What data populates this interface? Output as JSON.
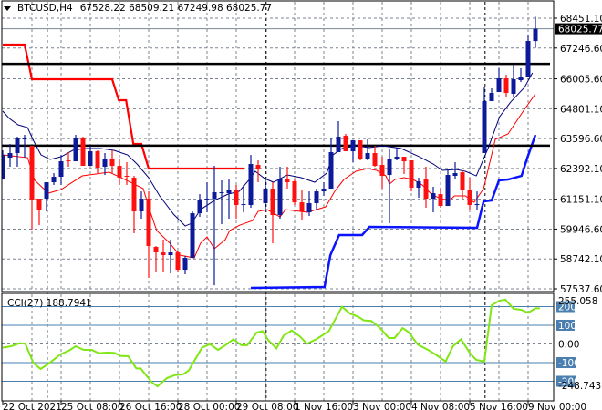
{
  "header": {
    "symbol": "BTCUSD,H4",
    "ohlc": "67528.22 68509.21 67249.98 68025.77"
  },
  "chart_data": {
    "type": "candlestick",
    "title": "BTCUSD,H4",
    "colors": {
      "bull": "#0c1a9a",
      "bear": "#ff1010",
      "ma_upper": "#00007a",
      "ma_lower": "#ff0000",
      "step_red": "#ff0000",
      "step_blue": "#0a14ff",
      "cci": "#80e614",
      "cci_level": "#4a7fb0",
      "grid": "#7a8490"
    },
    "price_axis_labels": [
      "68451.10",
      "67246.60",
      "66005.60",
      "64801.10",
      "63596.60",
      "62392.10",
      "61151.10",
      "59946.60",
      "58742.10",
      "57537.60"
    ],
    "price_range": [
      57537.6,
      68451.1
    ],
    "current_price": "68025.77",
    "x_axis_labels": [
      {
        "label": "22 Oct 2021",
        "bar": 0
      },
      {
        "label": "25 Oct 08:00",
        "bar": 8
      },
      {
        "label": "26 Oct 16:00",
        "bar": 16
      },
      {
        "label": "28 Oct 00:00",
        "bar": 24
      },
      {
        "label": "29 Oct 08:00",
        "bar": 32
      },
      {
        "label": "1 Nov 16:00",
        "bar": 40
      },
      {
        "label": "3 Nov 00:00",
        "bar": 48
      },
      {
        "label": "4 Nov 08:00",
        "bar": 56
      },
      {
        "label": "5 Nov 16:00",
        "bar": 64
      },
      {
        "label": "9 Nov 00:00",
        "bar": 72
      }
    ],
    "period_separators_bar": [
      6.1,
      36.1,
      66.1
    ],
    "candles_ohlc": [
      [
        61946,
        63122,
        61946,
        62938
      ],
      [
        62828,
        63379,
        62461,
        63012
      ],
      [
        63012,
        63673,
        62461,
        63600
      ],
      [
        63563,
        63747,
        62828,
        63637
      ],
      [
        63306,
        63306,
        59925,
        61101
      ],
      [
        61174,
        61174,
        60109,
        60733
      ],
      [
        61174,
        61836,
        60660,
        61836
      ],
      [
        61836,
        62203,
        61726,
        62056
      ],
      [
        62056,
        62938,
        61726,
        62681
      ],
      [
        62718,
        63049,
        62461,
        62681
      ],
      [
        62681,
        63747,
        62681,
        63600
      ],
      [
        63600,
        63673,
        62497,
        62497
      ],
      [
        62497,
        63306,
        62497,
        63085
      ],
      [
        63085,
        63122,
        62203,
        62424
      ],
      [
        62461,
        63012,
        62130,
        62791
      ],
      [
        62791,
        63122,
        62203,
        62497
      ],
      [
        62497,
        62755,
        61726,
        62020
      ],
      [
        62093,
        62644,
        61726,
        62056
      ],
      [
        62020,
        62093,
        59778,
        60660
      ],
      [
        60660,
        61468,
        60366,
        61174
      ],
      [
        61174,
        61468,
        57977,
        59263
      ],
      [
        59227,
        59263,
        58234,
        59006
      ],
      [
        59006,
        59521,
        58234,
        58896
      ],
      [
        58896,
        59521,
        58161,
        59006
      ],
      [
        59006,
        59080,
        58234,
        58308
      ],
      [
        58308,
        58859,
        58124,
        58786
      ],
      [
        58786,
        60660,
        58786,
        60586
      ],
      [
        60586,
        61358,
        60439,
        61138
      ],
      [
        61138,
        61836,
        60623,
        61174
      ],
      [
        61174,
        62497,
        57682,
        61432
      ],
      [
        61395,
        61909,
        60145,
        61432
      ],
      [
        61395,
        61946,
        60366,
        61542
      ],
      [
        61542,
        61726,
        60366,
        60917
      ],
      [
        60917,
        61726,
        60623,
        60954
      ],
      [
        60917,
        62938,
        60807,
        62571
      ],
      [
        62534,
        62718,
        61836,
        62350
      ],
      [
        60991,
        61946,
        60733,
        61579
      ],
      [
        61579,
        61836,
        59374,
        60513
      ],
      [
        60513,
        62461,
        60366,
        61946
      ],
      [
        61946,
        62461,
        61579,
        61836
      ],
      [
        61873,
        61946,
        60917,
        61027
      ],
      [
        61027,
        61505,
        60292,
        60660
      ],
      [
        60623,
        61468,
        60476,
        60991
      ],
      [
        60991,
        61579,
        60733,
        61468
      ],
      [
        61468,
        61836,
        61285,
        61579
      ],
      [
        61579,
        63600,
        61579,
        63049
      ],
      [
        63049,
        64298,
        63049,
        63673
      ],
      [
        63710,
        63784,
        63085,
        63085
      ],
      [
        63085,
        63526,
        62644,
        63526
      ],
      [
        63526,
        63526,
        62718,
        62755
      ],
      [
        62755,
        63563,
        62718,
        63012
      ],
      [
        63012,
        63306,
        62461,
        62497
      ],
      [
        62534,
        62865,
        61579,
        62093
      ],
      [
        62130,
        63196,
        60182,
        62791
      ],
      [
        62755,
        63232,
        62718,
        62865
      ],
      [
        62865,
        62865,
        62167,
        62681
      ],
      [
        62718,
        62718,
        61468,
        61615
      ],
      [
        61615,
        62020,
        61211,
        61873
      ],
      [
        61946,
        62461,
        60807,
        61174
      ],
      [
        61174,
        61652,
        60623,
        61395
      ],
      [
        61358,
        61615,
        60807,
        60880
      ],
      [
        60880,
        62387,
        60880,
        62130
      ],
      [
        62093,
        62644,
        61946,
        62203
      ],
      [
        62240,
        62314,
        61174,
        61542
      ],
      [
        61542,
        62020,
        60733,
        60917
      ],
      [
        60917,
        61468,
        60733,
        60954
      ],
      [
        63012,
        65658,
        63012,
        65107
      ],
      [
        65107,
        65621,
        65107,
        65437
      ],
      [
        65474,
        66430,
        65474,
        66025
      ],
      [
        66025,
        66172,
        65290,
        65437
      ],
      [
        65401,
        66577,
        65290,
        65989
      ],
      [
        65952,
        66430,
        65878,
        66099
      ],
      [
        66099,
        67789,
        66099,
        67532
      ],
      [
        67528.22,
        68509.21,
        67249.98,
        68025.77
      ]
    ],
    "horizontal_levels": [
      66610,
      63310
    ],
    "indicators": {
      "upper_ma": [
        [
          0,
          64703
        ],
        [
          0.9,
          64409
        ],
        [
          2.1,
          64151
        ],
        [
          3.4,
          64041
        ],
        [
          4.25,
          63490
        ],
        [
          5.25,
          62938
        ],
        [
          6.5,
          62755
        ],
        [
          8,
          62865
        ],
        [
          9.6,
          63122
        ],
        [
          11.25,
          63196
        ],
        [
          13.4,
          63196
        ],
        [
          15.25,
          63122
        ],
        [
          17.1,
          62938
        ],
        [
          18.4,
          62571
        ],
        [
          20,
          62020
        ],
        [
          21.5,
          61285
        ],
        [
          23.4,
          60550
        ],
        [
          25,
          60072
        ],
        [
          25.9,
          60182
        ],
        [
          27.1,
          60733
        ],
        [
          29,
          61101
        ],
        [
          30.9,
          61358
        ],
        [
          32.4,
          61468
        ],
        [
          34,
          62020
        ],
        [
          34.6,
          62277
        ],
        [
          35.9,
          61983
        ],
        [
          37.1,
          61836
        ],
        [
          39,
          62130
        ],
        [
          40.9,
          62020
        ],
        [
          42.75,
          61836
        ],
        [
          44.4,
          62203
        ],
        [
          45.25,
          62938
        ],
        [
          46.5,
          63196
        ],
        [
          48.4,
          63306
        ],
        [
          50.25,
          63232
        ],
        [
          52.1,
          63306
        ],
        [
          54.6,
          63196
        ],
        [
          57.1,
          62865
        ],
        [
          59,
          62571
        ],
        [
          60.25,
          62314
        ],
        [
          62.1,
          62350
        ],
        [
          63.4,
          62277
        ],
        [
          64.9,
          62093
        ],
        [
          66.5,
          63196
        ],
        [
          68.1,
          64482
        ],
        [
          69.6,
          65070
        ],
        [
          71.5,
          65658
        ],
        [
          72.6,
          66246
        ]
      ],
      "lower_ma": [
        [
          0,
          62938
        ],
        [
          3.4,
          62828
        ],
        [
          4.4,
          61909
        ],
        [
          6.25,
          61395
        ],
        [
          8,
          61542
        ],
        [
          10.9,
          62093
        ],
        [
          14.6,
          62240
        ],
        [
          16.75,
          61946
        ],
        [
          19.25,
          61579
        ],
        [
          20.25,
          60623
        ],
        [
          21.1,
          59888
        ],
        [
          22.9,
          59374
        ],
        [
          24.25,
          58896
        ],
        [
          26.25,
          58786
        ],
        [
          27.1,
          59374
        ],
        [
          28,
          59631
        ],
        [
          29,
          59153
        ],
        [
          30.5,
          59521
        ],
        [
          31.1,
          59888
        ],
        [
          32.5,
          60109
        ],
        [
          34.25,
          60292
        ],
        [
          35,
          60660
        ],
        [
          36.25,
          60733
        ],
        [
          38,
          60439
        ],
        [
          38.75,
          60733
        ],
        [
          41.75,
          60623
        ],
        [
          44.25,
          60844
        ],
        [
          45.5,
          61468
        ],
        [
          46.75,
          61946
        ],
        [
          48.4,
          62277
        ],
        [
          50,
          62387
        ],
        [
          51.25,
          62314
        ],
        [
          52.5,
          62093
        ],
        [
          53,
          61763
        ],
        [
          53.75,
          61946
        ],
        [
          55,
          62020
        ],
        [
          56.25,
          61946
        ],
        [
          57.5,
          61726
        ],
        [
          58.75,
          61358
        ],
        [
          60,
          61174
        ],
        [
          61.25,
          61101
        ],
        [
          61.9,
          61285
        ],
        [
          63.4,
          61285
        ],
        [
          64.6,
          61027
        ],
        [
          65.9,
          61579
        ],
        [
          67.5,
          63563
        ],
        [
          69.25,
          63784
        ],
        [
          71.25,
          64666
        ],
        [
          73,
          65401
        ]
      ],
      "step_resistance": [
        [
          0,
          67385
        ],
        [
          3,
          67385
        ],
        [
          4,
          65989
        ],
        [
          15,
          65989
        ],
        [
          15.9,
          65144
        ],
        [
          16.9,
          65144
        ],
        [
          17.9,
          63379
        ],
        [
          19,
          63379
        ],
        [
          20,
          62387
        ],
        [
          33.1,
          62387
        ]
      ],
      "step_support": [
        [
          34,
          57573
        ],
        [
          44.1,
          57610
        ],
        [
          44.9,
          58896
        ],
        [
          46.1,
          59705
        ],
        [
          49.25,
          59705
        ],
        [
          50.25,
          60035
        ],
        [
          65,
          59998
        ],
        [
          65.9,
          61064
        ],
        [
          67,
          61101
        ],
        [
          68,
          61909
        ],
        [
          69.25,
          61946
        ],
        [
          71.1,
          62093
        ],
        [
          71.9,
          62828
        ],
        [
          73,
          63747
        ]
      ]
    },
    "cci": {
      "label": "CCI(27) 188.7941",
      "max_label": "255.058",
      "min_label": "-248.7437",
      "levels": [
        {
          "value": 200,
          "label": "200"
        },
        {
          "value": 100,
          "label": "100"
        },
        {
          "value": 0,
          "label": "0.00"
        },
        {
          "value": -100,
          "label": "-100"
        },
        {
          "value": -200,
          "label": "-200"
        }
      ],
      "points": [
        [
          0,
          -20
        ],
        [
          1.2,
          -12
        ],
        [
          2.3,
          4
        ],
        [
          3.1,
          1
        ],
        [
          4.2,
          -102
        ],
        [
          5.2,
          -134
        ],
        [
          6.3,
          -105
        ],
        [
          7.9,
          -56
        ],
        [
          9.2,
          -33
        ],
        [
          10,
          -12
        ],
        [
          11.1,
          -32
        ],
        [
          12.2,
          -32
        ],
        [
          13.2,
          -50
        ],
        [
          14.3,
          -46
        ],
        [
          15.35,
          -48
        ],
        [
          16.15,
          -64
        ],
        [
          17.2,
          -66
        ],
        [
          18.3,
          -131
        ],
        [
          18.9,
          -131
        ],
        [
          20.4,
          -204
        ],
        [
          21.2,
          -227
        ],
        [
          22.5,
          -183
        ],
        [
          23.6,
          -167
        ],
        [
          24.7,
          -163
        ],
        [
          25.5,
          -142
        ],
        [
          27.3,
          -20
        ],
        [
          28.4,
          -1
        ],
        [
          29.5,
          -32
        ],
        [
          30.5,
          -7
        ],
        [
          31.6,
          25
        ],
        [
          32.7,
          -7
        ],
        [
          33.5,
          -7
        ],
        [
          34.8,
          61
        ],
        [
          35.6,
          69
        ],
        [
          36.4,
          20
        ],
        [
          37.5,
          -24
        ],
        [
          38.5,
          45
        ],
        [
          39.6,
          72
        ],
        [
          40.7,
          41
        ],
        [
          41.7,
          1
        ],
        [
          43.1,
          28
        ],
        [
          44.7,
          69
        ],
        [
          46.5,
          199
        ],
        [
          47.6,
          162
        ],
        [
          48.7,
          146
        ],
        [
          49.5,
          126
        ],
        [
          50.5,
          123
        ],
        [
          51.6,
          90
        ],
        [
          52.9,
          32
        ],
        [
          53.7,
          32
        ],
        [
          54.8,
          85
        ],
        [
          55.6,
          64
        ],
        [
          56.9,
          -4
        ],
        [
          58.3,
          -32
        ],
        [
          59.6,
          -64
        ],
        [
          60.7,
          -94
        ],
        [
          61.7,
          -12
        ],
        [
          62.8,
          25
        ],
        [
          64.1,
          -53
        ],
        [
          64.9,
          -85
        ],
        [
          66,
          -94
        ],
        [
          67,
          207
        ],
        [
          68.1,
          232
        ],
        [
          68.9,
          237
        ],
        [
          70,
          188
        ],
        [
          71.05,
          183
        ],
        [
          72,
          167
        ],
        [
          73,
          191
        ],
        [
          73.6,
          191
        ]
      ]
    }
  }
}
